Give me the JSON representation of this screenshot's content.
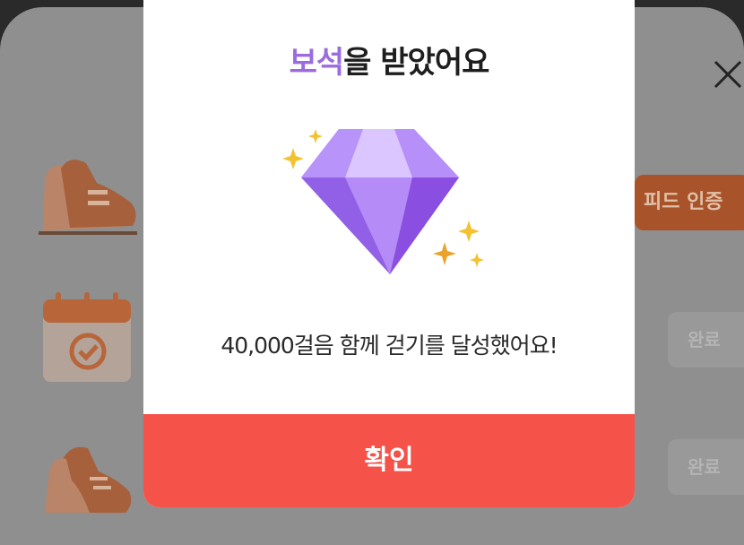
{
  "background": {
    "feed_button_label": "피드 인증",
    "done_label_1": "완료",
    "done_label_2": "완료"
  },
  "modal": {
    "title_accent": "보석",
    "title_rest": "을 받았어요",
    "message": "40,000걸음 함께 걷기를 달성했어요!",
    "confirm_label": "확인"
  },
  "colors": {
    "accent_purple": "#9b6be0",
    "confirm_red": "#f55349",
    "feed_orange": "#a9532a"
  }
}
